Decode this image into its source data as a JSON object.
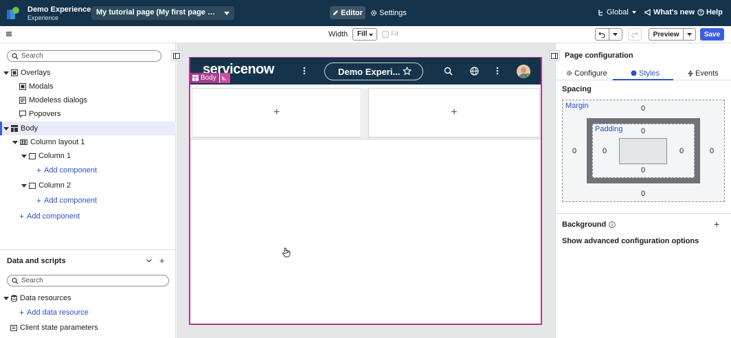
{
  "topbar": {
    "app_title": "Demo Experience",
    "app_subtitle": "Experience",
    "page_selector": "My tutorial page (My first page varia...",
    "editor_label": "Editor",
    "settings_label": "Settings",
    "global_label": "Global",
    "whats_new_label": "What's new",
    "help_label": "Help"
  },
  "toolbar": {
    "width_label": "Width",
    "width_value": "Fill",
    "fit_label": "Fit",
    "preview_label": "Preview",
    "save_label": "Save"
  },
  "left_panel": {
    "search_placeholder": "Search",
    "tree": {
      "overlays": "Overlays",
      "modals": "Modals",
      "modeless": "Modeless dialogs",
      "popovers": "Popovers",
      "body": "Body",
      "column_layout": "Column layout 1",
      "column1": "Column 1",
      "add_component_1": "Add component",
      "column2": "Column 2",
      "add_component_2": "Add component",
      "add_component_root": "Add component"
    },
    "data_section": {
      "title": "Data and scripts",
      "search_placeholder": "Search",
      "data_resources": "Data resources",
      "add_data_resource": "Add data resource",
      "client_state": "Client state parameters"
    }
  },
  "canvas": {
    "brand_logo": "servicenow",
    "experience_pill": "Demo Experi...",
    "body_tag": "Body",
    "col1_plus": "+",
    "col2_plus": "+"
  },
  "right_panel": {
    "title": "Page configuration",
    "tabs": {
      "configure": "Configure",
      "styles": "Styles",
      "events": "Events"
    },
    "spacing_title": "Spacing",
    "margin": {
      "label": "Margin",
      "top": "0",
      "right": "0",
      "bottom": "0",
      "left": "0"
    },
    "padding": {
      "label": "Padding",
      "top": "0",
      "right": "0",
      "bottom": "0",
      "left": "0"
    },
    "background_title": "Background",
    "advanced_options": "Show advanced configuration options"
  },
  "colors": {
    "header_bg": "#15334a",
    "accent": "#3a5fe0",
    "selection_frame": "#b03a8f",
    "link": "#2851c9"
  }
}
